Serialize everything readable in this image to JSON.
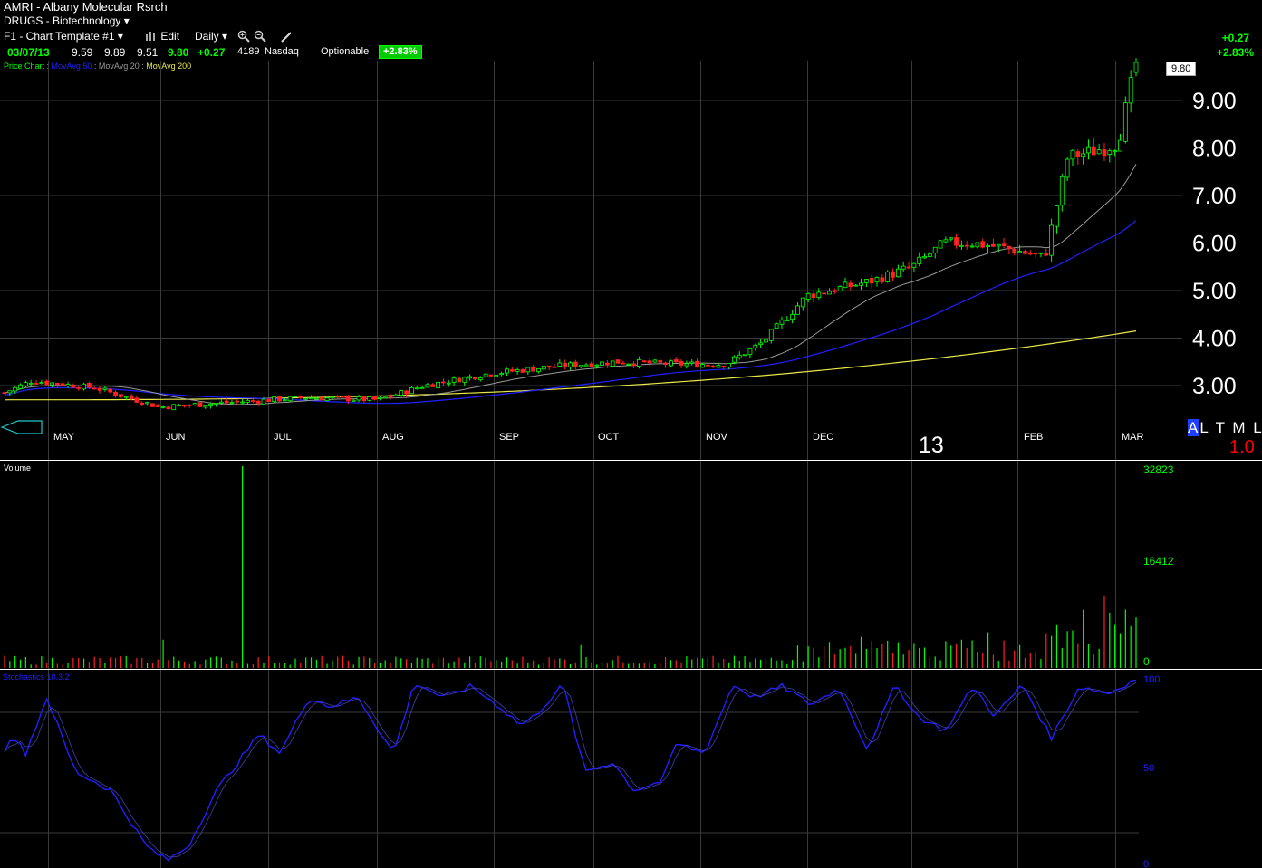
{
  "header": {
    "symbol": "AMRI",
    "separator": " - ",
    "company": "Albany Molecular Rsrch",
    "industry": "DRUGS - Biotechnology",
    "template": "F1 - Chart Template #1",
    "edit_label": "Edit",
    "period": "Daily",
    "date": "03/07/13",
    "open": "9.59",
    "high": "9.89",
    "low": "9.51",
    "last": "9.80",
    "change": "+0.27",
    "volume": "4189",
    "exchange": "Nasdaq",
    "optionable": "Optionable",
    "change_pct": "+2.83%",
    "right_change": "+0.27",
    "right_change_pct": "+2.83%",
    "price_box": "9.80"
  },
  "legend": {
    "price_chart": "Price Chart",
    "ma50": "MovAvg 50",
    "ma20": "MovAvg 20",
    "ma200": "MovAvg 200",
    "colors": {
      "ma50": "#2020ff",
      "ma20": "#999999",
      "ma200": "#e8e84a"
    }
  },
  "colors": {
    "up": "#00ff00",
    "down": "#ff2020",
    "grid": "#3a3a3a",
    "stoch": "#2020ff"
  },
  "axis": {
    "y_labels": [
      "9.00",
      "8.00",
      "7.00",
      "6.00",
      "5.00",
      "4.00",
      "3.00"
    ],
    "months": [
      "MAY",
      "JUN",
      "JUL",
      "AUG",
      "SEP",
      "OCT",
      "NOV",
      "DEC",
      "FEB",
      "MAR"
    ],
    "year": "13"
  },
  "volume": {
    "title": "Volume",
    "labels": [
      "32823",
      "16412",
      "0"
    ]
  },
  "stochastic": {
    "title": "Stochastics 10.3.2",
    "labels": [
      "100",
      "50",
      "0"
    ]
  },
  "view_buttons": {
    "a": "A",
    "rest": "L T M L"
  },
  "ratio": "1.0",
  "icons": [
    "dropdown-arrow-icon",
    "bar-chart-icon",
    "zoom-in-icon",
    "zoom-out-icon",
    "pencil-icon",
    "scroll-arrow-icon"
  ]
}
